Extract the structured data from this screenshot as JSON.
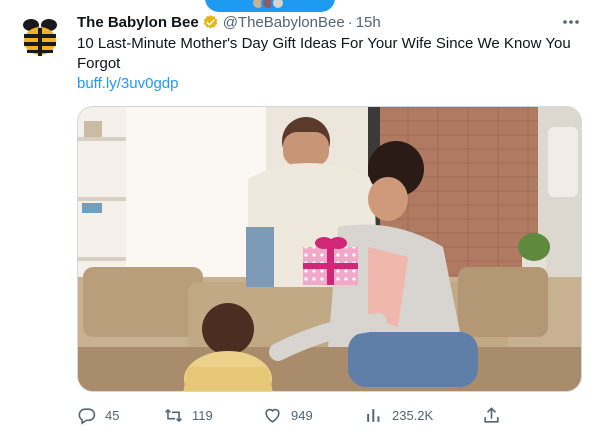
{
  "tweet": {
    "author_name": "The Babylon Bee",
    "handle": "@TheBabylonBee",
    "separator": "·",
    "time": "15h",
    "verified_color": "#e2b719",
    "text": "10 Last-Minute Mother's Day Gift Ideas For Your Wife Since We Know You Forgot",
    "link": "buff.ly/3uv0gdp",
    "link_color": "#1d9bf0"
  },
  "actions": {
    "replies": "45",
    "retweets": "119",
    "likes": "949",
    "views": "235.2K"
  },
  "icons": {
    "avatar": "bee-logo-icon",
    "verified": "verified-badge-icon",
    "more": "more-dots-icon",
    "reply": "reply-icon",
    "retweet": "retweet-icon",
    "like": "heart-icon",
    "views": "views-chart-icon",
    "share": "share-icon"
  }
}
